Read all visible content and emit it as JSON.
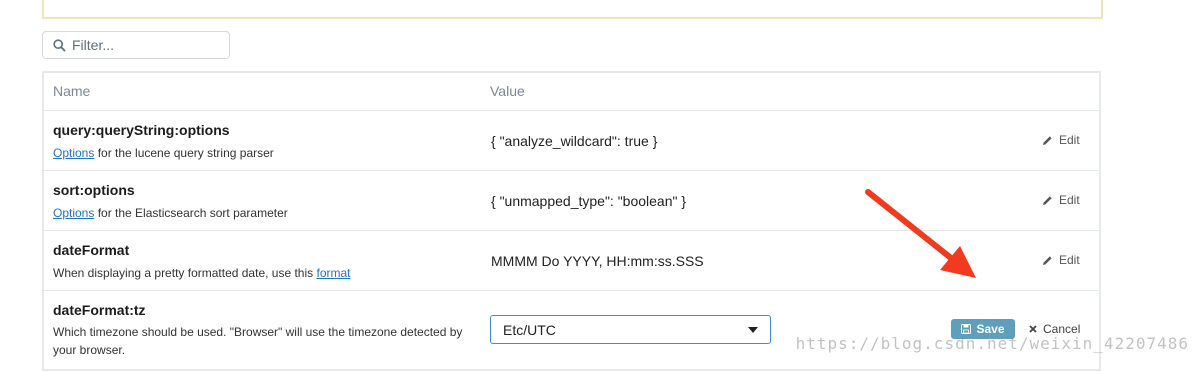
{
  "filter": {
    "placeholder": "Filter..."
  },
  "table": {
    "headers": {
      "name": "Name",
      "value": "Value"
    },
    "rows": [
      {
        "name": "query:queryString:options",
        "desc_link": "Options",
        "desc_text": " for the lucene query string parser",
        "value": "{ \"analyze_wildcard\": true }",
        "edit": "Edit"
      },
      {
        "name": "sort:options",
        "desc_link": "Options",
        "desc_text": " for the Elasticsearch sort parameter",
        "value": "{ \"unmapped_type\": \"boolean\" }",
        "edit": "Edit"
      },
      {
        "name": "dateFormat",
        "desc_text": "When displaying a pretty formatted date, use this ",
        "desc_link": "format",
        "value": "MMMM Do YYYY, HH:mm:ss.SSS",
        "edit": "Edit"
      },
      {
        "name": "dateFormat:tz",
        "desc_text": "Which timezone should be used. \"Browser\" will use the timezone detected by your browser.",
        "select_value": "Etc/UTC",
        "save": "Save",
        "cancel": "Cancel"
      }
    ]
  },
  "watermark": "https://blog.csdn.net/weixin_42207486",
  "colors": {
    "link": "#1c78b8",
    "save_button": "#5f9fbd",
    "arrow": "#f23a1f"
  }
}
